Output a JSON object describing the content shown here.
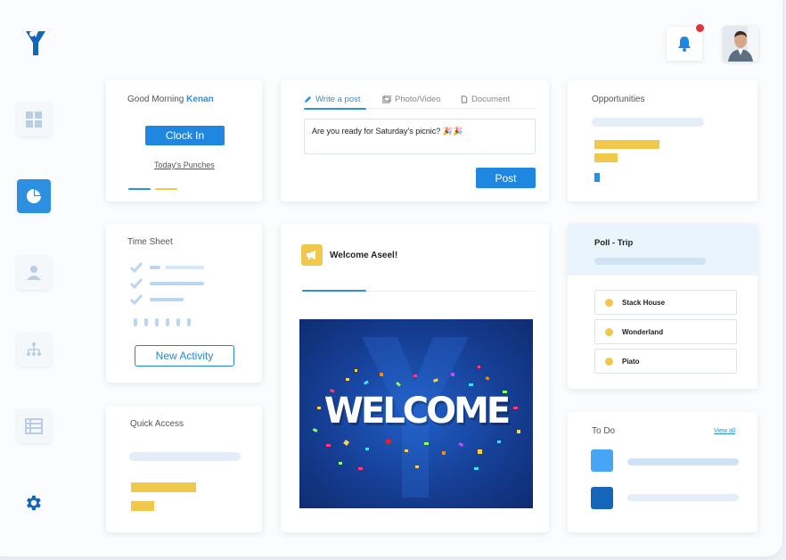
{
  "colors": {
    "primary": "#2d8fdf",
    "accent_yellow": "#f0c94c",
    "light_blue": "#d6e8f7",
    "dark_blue": "#1566b8"
  },
  "sidebar": {
    "items": [
      {
        "icon": "grid-icon"
      },
      {
        "icon": "pie-chart-icon",
        "active": true
      },
      {
        "icon": "user-icon"
      },
      {
        "icon": "org-chart-icon"
      },
      {
        "icon": "table-icon"
      }
    ],
    "settings_icon": "gear-icon"
  },
  "header": {
    "notification_icon": "bell-icon",
    "has_notification": true
  },
  "greeting": {
    "prefix": "Good Morning",
    "name": "Kenan",
    "clock_in_label": "Clock In",
    "punches_link": "Today's Punches"
  },
  "composer": {
    "tabs": [
      {
        "label": "Write a post",
        "icon": "pencil-icon",
        "active": true
      },
      {
        "label": "Photo/Video",
        "icon": "photo-icon"
      },
      {
        "label": "Document",
        "icon": "document-icon"
      }
    ],
    "text": "Are you ready for Saturday's picnic? 🎉🎉",
    "post_label": "Post"
  },
  "opportunities": {
    "title": "Opportunities"
  },
  "timesheet": {
    "title": "Time Sheet",
    "new_activity_label": "New Activity"
  },
  "welcome": {
    "title": "Welcome Aseel!",
    "banner_text": "WELCOME",
    "icon": "megaphone-icon"
  },
  "poll": {
    "title": "Poll - Trip",
    "options": [
      "Stack House",
      "Wonderland",
      "Piato"
    ]
  },
  "quick_access": {
    "title": "Quick Access"
  },
  "todo": {
    "title": "To Do",
    "view_all": "View all"
  }
}
